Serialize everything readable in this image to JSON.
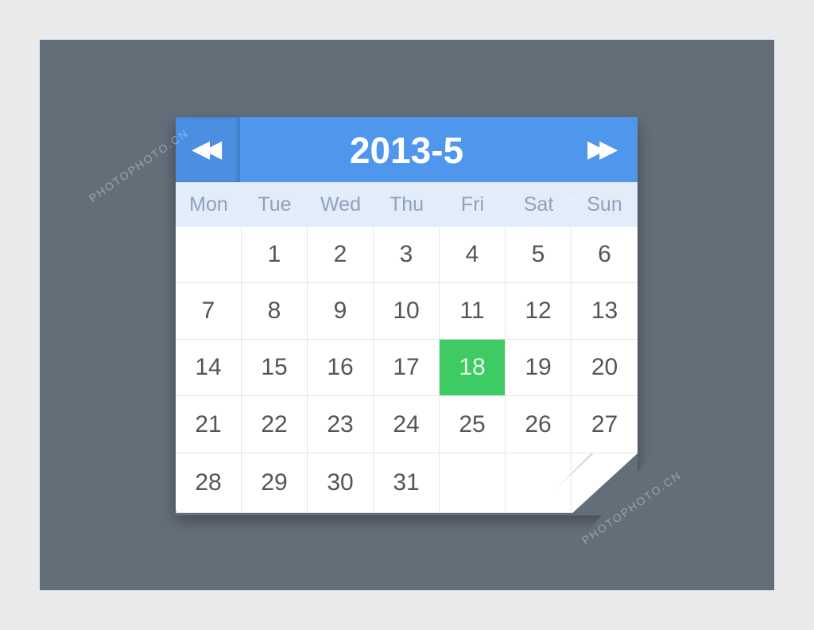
{
  "calendar": {
    "title": "2013-5",
    "prev_icon": "double-chevron-left-icon",
    "next_icon": "double-chevron-right-icon",
    "prev_glyph": "◀◀",
    "next_glyph": "▶▶",
    "weekdays": [
      "Mon",
      "Tue",
      "Wed",
      "Thu",
      "Fri",
      "Sat",
      "Sun"
    ],
    "days": [
      "",
      "1",
      "2",
      "3",
      "4",
      "5",
      "6",
      "7",
      "8",
      "9",
      "10",
      "11",
      "12",
      "13",
      "14",
      "15",
      "16",
      "17",
      "18",
      "19",
      "20",
      "21",
      "22",
      "23",
      "24",
      "25",
      "26",
      "27",
      "28",
      "29",
      "30",
      "31",
      "",
      "",
      ""
    ],
    "selected_day": "18",
    "colors": {
      "header": "#4f97ec",
      "selected": "#3ecb63",
      "weekday_bg": "#e2edf9",
      "background": "#646e79"
    }
  },
  "watermark": "PHOTOPHOTO.CN"
}
